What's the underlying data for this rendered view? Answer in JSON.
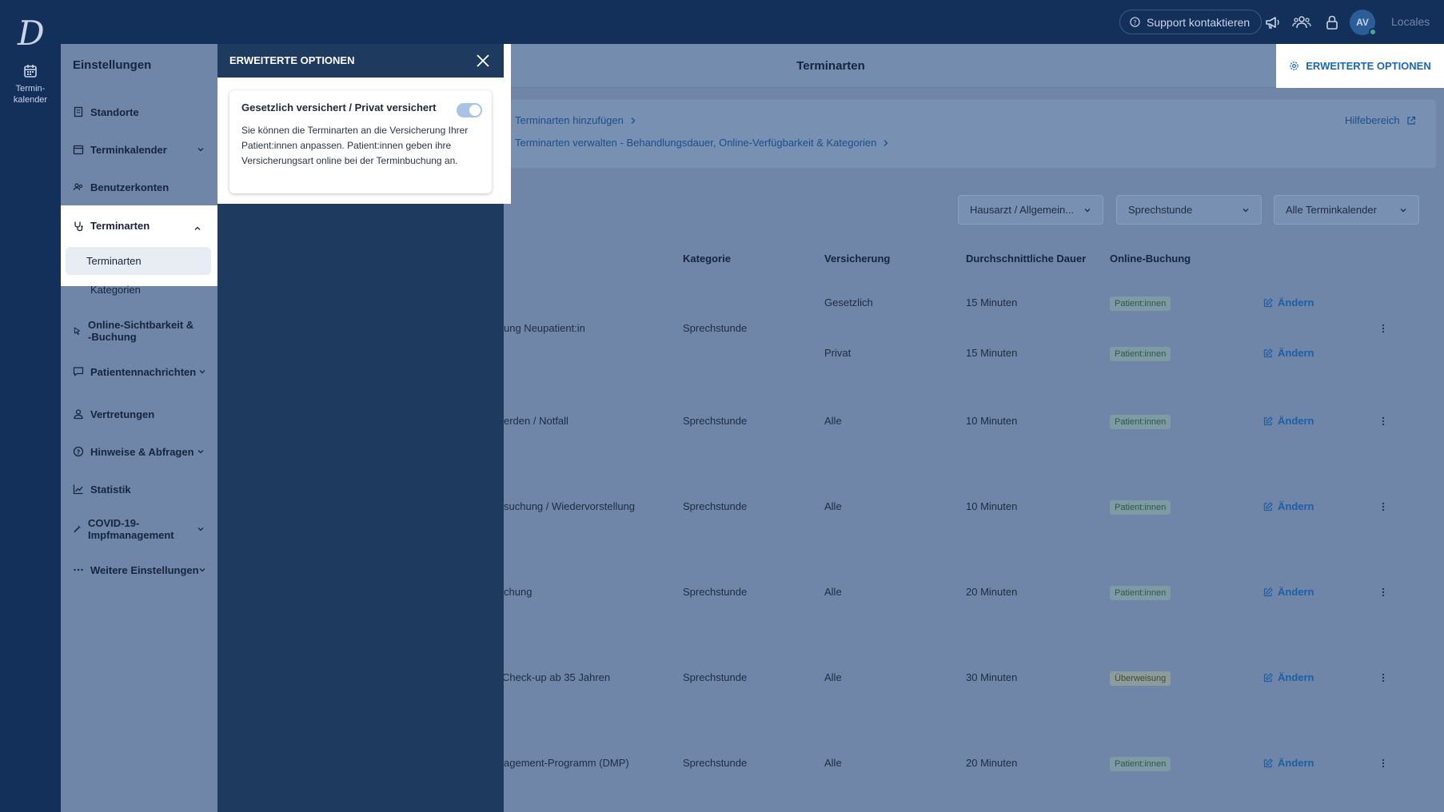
{
  "rail": {
    "logo_letter": "D",
    "items": [
      {
        "label": "Termin-\nkalender",
        "icon": "calendar-icon"
      }
    ]
  },
  "topbar": {
    "support_label": "Support kontaktieren",
    "avatar_initials": "AV",
    "locales_label": "Locales"
  },
  "sidebar": {
    "title": "Einstellungen",
    "items": [
      {
        "label": "Standorte",
        "icon": "building-icon"
      },
      {
        "label": "Terminkalender",
        "icon": "calendar-icon"
      },
      {
        "label": "Benutzerkonten",
        "icon": "users-icon"
      },
      {
        "label": "Terminarten",
        "icon": "stethoscope-icon"
      },
      {
        "label": "Online-Sichtbarkeit & -Buchung",
        "icon": "cursor-icon"
      },
      {
        "label": "Patientennachrichten",
        "icon": "message-icon"
      },
      {
        "label": "Vertretungen",
        "icon": "person-icon"
      },
      {
        "label": "Hinweise & Abfragen",
        "icon": "question-icon"
      },
      {
        "label": "Statistik",
        "icon": "chart-icon"
      },
      {
        "label": "COVID-19-Impfmanagement",
        "icon": "syringe-icon"
      },
      {
        "label": "Weitere Einstellungen",
        "icon": "dots-icon"
      }
    ],
    "sub_items": [
      "Terminarten",
      "Kategorien"
    ]
  },
  "main": {
    "title": "Terminarten",
    "extended_button": "ERWEITERTE OPTIONEN",
    "help_links": [
      "Terminarten hinzufügen",
      "Terminarten verwalten - Behandlungsdauer, Online-Verfügbarkeit & Kategorien"
    ],
    "help_area": "Hilfebereich",
    "filters": [
      "Hausarzt / Allgemein...",
      "Sprechstunde",
      "Alle Terminkalender"
    ],
    "columns": [
      "Kategorie",
      "Versicherung",
      "Durchschnittliche Dauer",
      "Online-Buchung"
    ],
    "edit_label": "Ändern",
    "rows": [
      {
        "name": "ung Neupatient:in",
        "category": "Sprechstunde",
        "lines": [
          {
            "insurance": "Gesetzlich",
            "duration": "15 Minuten",
            "booking": "Patient:innen"
          },
          {
            "insurance": "Privat",
            "duration": "15 Minuten",
            "booking": "Patient:innen"
          }
        ]
      },
      {
        "name": "erden / Notfall",
        "category": "Sprechstunde",
        "insurance": "Alle",
        "duration": "10 Minuten",
        "booking": "Patient:innen"
      },
      {
        "name": "suchung / Wiedervorstellung",
        "category": "Sprechstunde",
        "insurance": "Alle",
        "duration": "10 Minuten",
        "booking": "Patient:innen"
      },
      {
        "name": "chung",
        "category": "Sprechstunde",
        "insurance": "Alle",
        "duration": "20 Minuten",
        "booking": "Patient:innen"
      },
      {
        "name": "Check-up ab 35 Jahren",
        "category": "Sprechstunde",
        "insurance": "Alle",
        "duration": "30 Minuten",
        "booking": "Überweisung"
      },
      {
        "name": "agement-Programm (DMP)",
        "category": "Sprechstunde",
        "insurance": "Alle",
        "duration": "20 Minuten",
        "booking": "Patient:innen"
      }
    ]
  },
  "modal": {
    "title": "ERWEITERTE OPTIONEN",
    "option_title": "Gesetzlich versichert / Privat versichert",
    "option_desc": "Sie können die Terminarten an die Versicherung Ihrer Patient:innen anpassen. Patient:innen geben ihre Versicherungsart online bei der Terminbuchung an.",
    "toggle_on": true
  },
  "colors": {
    "navy": "#13305a",
    "overlay": "#1e3a5f",
    "accent": "#1a67b8",
    "dimmed": "#6f86a8"
  }
}
